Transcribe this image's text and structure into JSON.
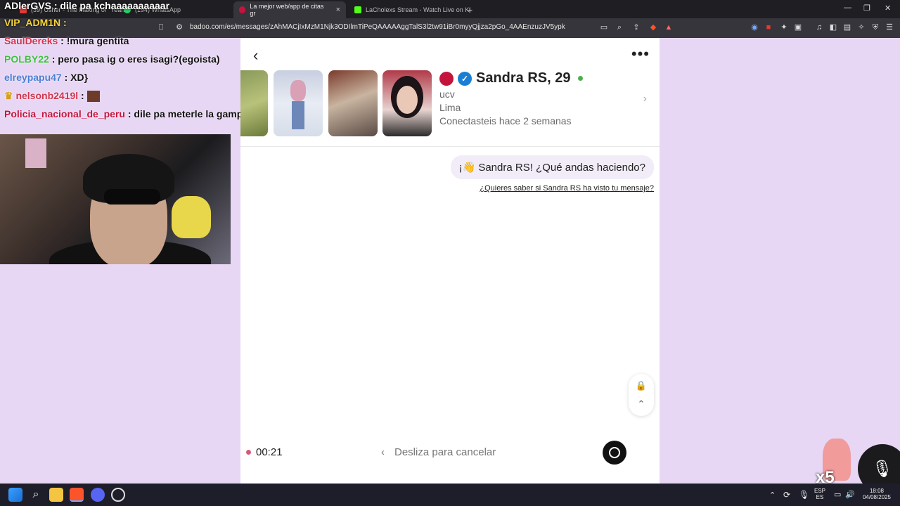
{
  "browser": {
    "tabs": [
      {
        "title": "(39) Usher - The Making of \"Yeah\"",
        "active": false
      },
      {
        "title": "(194) WhatsApp",
        "active": false
      },
      {
        "title": "La mejor web/app de citas gr",
        "active": true
      },
      {
        "title": "LaCholexs Stream - Watch Live on Ki",
        "active": false
      }
    ],
    "new_tab": "+",
    "url": "badoo.com/es/messages/zAhMACjIxMzM1Njk3ODIlmTiPeQAAAAAggTalS3l2tw91iBr0myyQjjza2pGo_4AAEnzuzJV5ypk"
  },
  "stream_chat": [
    {
      "user": "ADlerGVS",
      "message": ": dile pa kchaaaaaaaaaar",
      "user_color": "#111111"
    },
    {
      "user": "VIP_ADM1N",
      "message": ":",
      "user_color": "#111111"
    },
    {
      "user": "SaulDereks",
      "message": ": !mura gentita",
      "user_color": "#d0354c"
    },
    {
      "user": "POLBY22",
      "message": ": pero pasa ig o eres isagi?(egoista)",
      "user_color": "#3cc23c"
    },
    {
      "user": "elreypapu47",
      "message": ": XD}",
      "user_color": "#4a7fd4"
    },
    {
      "user": "nelsonb2419l",
      "message": ":",
      "user_color": "#d0354c"
    },
    {
      "user": "Policia_nacional_de_peru",
      "message": ": dile pa meterle la gampi",
      "user_color": "#c4143c"
    }
  ],
  "badoo": {
    "profile": {
      "name": "Sandra RS, 29",
      "school": "ucv",
      "city": "Lima",
      "connected": "Conectasteis hace 2 semanas"
    },
    "message": "¡👋 Sandra RS! ¿Qué andas haciendo?",
    "seen_prompt": "¿Quieres saber si Sandra RS ha visto tu mensaje?",
    "recording": {
      "time": "00:21",
      "cancel_hint": "Desliza para cancelar"
    }
  },
  "stream_overlay": {
    "multiplier": "x5"
  },
  "taskbar": {
    "lang_top": "ESP",
    "lang_bottom": "ES",
    "time": "18:08",
    "date": "04/08/2025"
  }
}
